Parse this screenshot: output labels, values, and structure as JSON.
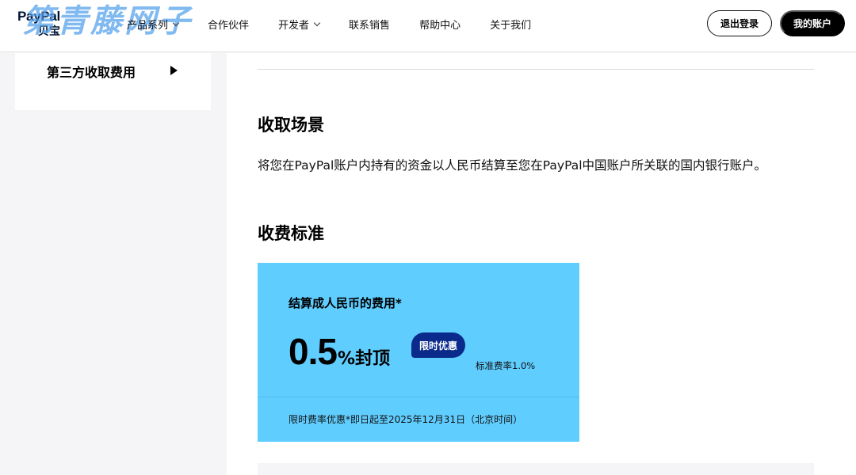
{
  "header": {
    "logo_text": "PayPal",
    "logo_sub": "贝宝",
    "watermark": "第青藤网子",
    "nav": [
      {
        "label": "产品系列",
        "has_dropdown": true
      },
      {
        "label": "合作伙伴",
        "has_dropdown": false
      },
      {
        "label": "开发者",
        "has_dropdown": true
      },
      {
        "label": "联系销售",
        "has_dropdown": false
      },
      {
        "label": "帮助中心",
        "has_dropdown": false
      },
      {
        "label": "关于我们",
        "has_dropdown": false
      }
    ],
    "logout_label": "退出登录",
    "account_label": "我的账户"
  },
  "sidebar": {
    "item_label": "第三方收取费用"
  },
  "main": {
    "scene_heading": "收取场景",
    "scene_text": "将您在PayPal账户内持有的资金以人民币结算至您在PayPal中国账户所关联的国内银行账户。",
    "standard_heading": "收费标准",
    "fee_card": {
      "title": "结算成人民币的费用*",
      "rate_value": "0.5",
      "rate_suffix": "%封顶",
      "promo_badge": "限时优惠",
      "standard_rate": "标准费率1.0%",
      "note": "限时费率优惠*即日起至2025年12月31日（北京时间）",
      "background_color": "#60cdff",
      "badge_color": "#0a2a8c"
    }
  }
}
